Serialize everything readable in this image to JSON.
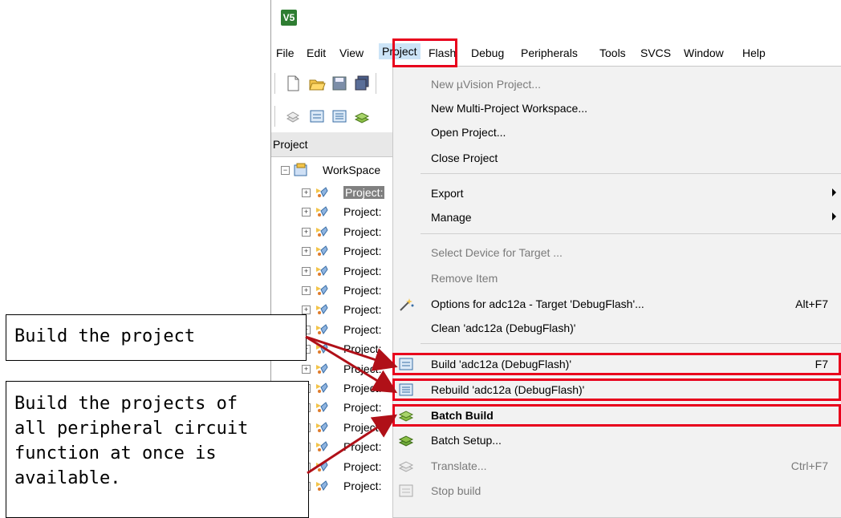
{
  "app": {
    "logo_text": "V5",
    "menu": [
      "File",
      "Edit",
      "View",
      "Project",
      "Flash",
      "Debug",
      "Peripherals",
      "Tools",
      "SVCS",
      "Window",
      "Help"
    ]
  },
  "project_panel": {
    "header": "Project",
    "workspace_label": "WorkSpace",
    "project_label": "Project:"
  },
  "project_menu": {
    "items": [
      {
        "label": "New µVision Project...",
        "disabled": true
      },
      {
        "label": "New Multi-Project Workspace..."
      },
      {
        "label": "Open Project..."
      },
      {
        "label": "Close Project"
      },
      {
        "label": "Export",
        "submenu": true
      },
      {
        "label": "Manage",
        "submenu": true
      },
      {
        "label": "Select Device for Target ...",
        "disabled": true
      },
      {
        "label": "Remove Item",
        "disabled": true
      },
      {
        "label": "Options for adc12a - Target 'DebugFlash'...",
        "shortcut": "Alt+F7"
      },
      {
        "label": "Clean 'adc12a (DebugFlash)'"
      },
      {
        "label": "Build 'adc12a (DebugFlash)'",
        "shortcut": "F7"
      },
      {
        "label": "Rebuild 'adc12a (DebugFlash)'"
      },
      {
        "label": "Batch Build",
        "bold": true
      },
      {
        "label": "Batch Setup..."
      },
      {
        "label": "Translate...",
        "shortcut": "Ctrl+F7",
        "disabled": true
      },
      {
        "label": "Stop build",
        "disabled": true
      }
    ]
  },
  "callouts": {
    "build": "Build the project",
    "batch_lines": [
      "Build the projects of",
      "all peripheral circuit",
      "function at once is",
      "available."
    ]
  },
  "colors": {
    "highlight": "#e8001c",
    "arrow": "#b01018",
    "menu_bg": "#f2f2f2"
  }
}
